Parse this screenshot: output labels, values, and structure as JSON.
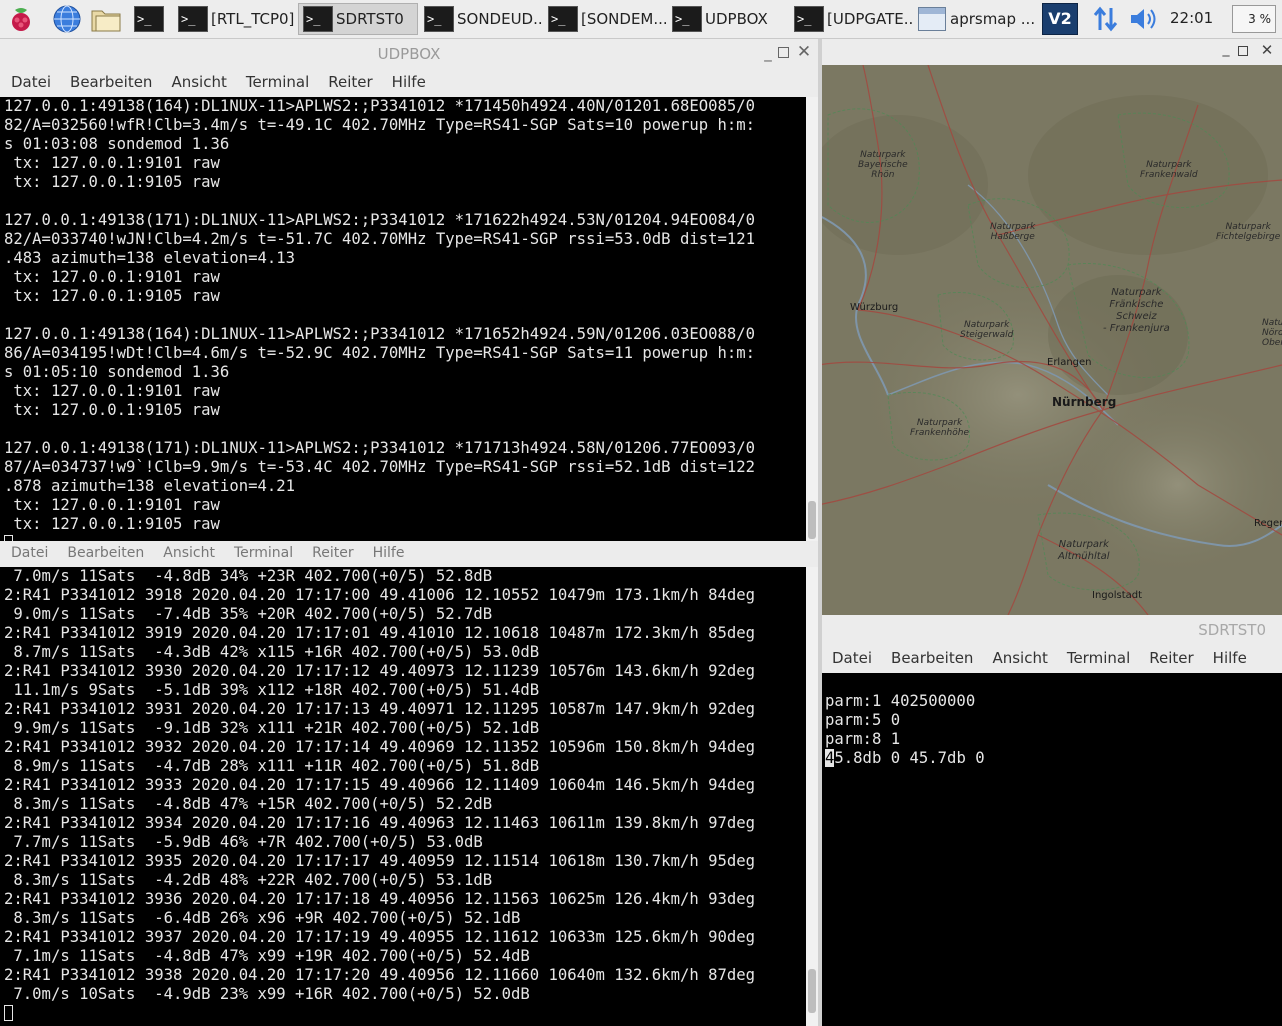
{
  "taskbar": {
    "tasks": [
      {
        "label": "",
        "glyph": ">_"
      },
      {
        "label": "[RTL_TCP0]",
        "glyph": ">_"
      },
      {
        "label": "SDRTST0",
        "glyph": ">_"
      },
      {
        "label": "SONDEUD...",
        "glyph": ">_"
      },
      {
        "label": "[SONDEM...",
        "glyph": ">_"
      },
      {
        "label": "UDPBOX",
        "glyph": ">_"
      },
      {
        "label": "[UDPGATE...",
        "glyph": ">_"
      },
      {
        "label": "aprsmap ...",
        "glyph": ""
      }
    ],
    "clock": "22:01",
    "cpu": "3 %",
    "vnc_label": "V2"
  },
  "udpbox": {
    "title": "UDPBOX",
    "menu": [
      "Datei",
      "Bearbeiten",
      "Ansicht",
      "Terminal",
      "Reiter",
      "Hilfe"
    ],
    "lines": [
      "127.0.0.1:49138(164):DL1NUX-11>APLWS2:;P3341012 *171450h4924.40N/01201.68EO085/0",
      "82/A=032560!wfR!Clb=3.4m/s t=-49.1C 402.70MHz Type=RS41-SGP Sats=10 powerup h:m:",
      "s 01:03:08 sondemod 1.36",
      " tx: 127.0.0.1:9101 raw",
      " tx: 127.0.0.1:9105 raw",
      "",
      "127.0.0.1:49138(171):DL1NUX-11>APLWS2:;P3341012 *171622h4924.53N/01204.94EO084/0",
      "82/A=033740!wJN!Clb=4.2m/s t=-51.7C 402.70MHz Type=RS41-SGP rssi=53.0dB dist=121",
      ".483 azimuth=138 elevation=4.13",
      " tx: 127.0.0.1:9101 raw",
      " tx: 127.0.0.1:9105 raw",
      "",
      "127.0.0.1:49138(164):DL1NUX-11>APLWS2:;P3341012 *171652h4924.59N/01206.03EO088/0",
      "86/A=034195!wDt!Clb=4.6m/s t=-52.9C 402.70MHz Type=RS41-SGP Sats=11 powerup h:m:",
      "s 01:05:10 sondemod 1.36",
      " tx: 127.0.0.1:9101 raw",
      " tx: 127.0.0.1:9105 raw",
      "",
      "127.0.0.1:49138(171):DL1NUX-11>APLWS2:;P3341012 *171713h4924.58N/01206.77EO093/0",
      "87/A=034737!w9`!Clb=9.9m/s t=-53.4C 402.70MHz Type=RS41-SGP rssi=52.1dB dist=122",
      ".878 azimuth=138 elevation=4.21",
      " tx: 127.0.0.1:9101 raw",
      " tx: 127.0.0.1:9105 raw"
    ]
  },
  "sondeud": {
    "ghost_menu": [
      "Datei",
      "Bearbeiten",
      "Ansicht",
      "Terminal",
      "Reiter",
      "Hilfe"
    ],
    "lines": [
      " 7.0m/s 11Sats  -4.8dB 34% +23R 402.700(+0/5) 52.8dB",
      "2:R41 P3341012 3918 2020.04.20 17:17:00 49.41006 12.10552 10479m 173.1km/h 84deg",
      " 9.0m/s 11Sats  -7.4dB 35% +20R 402.700(+0/5) 52.7dB",
      "2:R41 P3341012 3919 2020.04.20 17:17:01 49.41010 12.10618 10487m 172.3km/h 85deg",
      " 8.7m/s 11Sats  -4.3dB 42% x115 +16R 402.700(+0/5) 53.0dB",
      "2:R41 P3341012 3930 2020.04.20 17:17:12 49.40973 12.11239 10576m 143.6km/h 92deg",
      " 11.1m/s 9Sats  -5.1dB 39% x112 +18R 402.700(+0/5) 51.4dB",
      "2:R41 P3341012 3931 2020.04.20 17:17:13 49.40971 12.11295 10587m 147.9km/h 92deg",
      " 9.9m/s 11Sats  -9.1dB 32% x111 +21R 402.700(+0/5) 52.1dB",
      "2:R41 P3341012 3932 2020.04.20 17:17:14 49.40969 12.11352 10596m 150.8km/h 94deg",
      " 8.9m/s 11Sats  -4.7dB 28% x111 +11R 402.700(+0/5) 51.8dB",
      "2:R41 P3341012 3933 2020.04.20 17:17:15 49.40966 12.11409 10604m 146.5km/h 94deg",
      " 8.3m/s 11Sats  -4.8dB 47% +15R 402.700(+0/5) 52.2dB",
      "2:R41 P3341012 3934 2020.04.20 17:17:16 49.40963 12.11463 10611m 139.8km/h 97deg",
      " 7.7m/s 11Sats  -5.9dB 46% +7R 402.700(+0/5) 53.0dB",
      "2:R41 P3341012 3935 2020.04.20 17:17:17 49.40959 12.11514 10618m 130.7km/h 95deg",
      " 8.3m/s 11Sats  -4.2dB 48% +22R 402.700(+0/5) 53.1dB",
      "2:R41 P3341012 3936 2020.04.20 17:17:18 49.40956 12.11563 10625m 126.4km/h 93deg",
      " 8.3m/s 11Sats  -6.4dB 26% x96 +9R 402.700(+0/5) 52.1dB",
      "2:R41 P3341012 3937 2020.04.20 17:17:19 49.40955 12.11612 10633m 125.6km/h 90deg",
      " 7.1m/s 11Sats  -4.8dB 47% x99 +19R 402.700(+0/5) 52.4dB",
      "2:R41 P3341012 3938 2020.04.20 17:17:20 49.40956 12.11660 10640m 132.6km/h 87deg",
      " 7.0m/s 10Sats  -4.9dB 23% x99 +16R 402.700(+0/5) 52.0dB"
    ]
  },
  "sdrtst": {
    "title": "SDRTST0",
    "menu": [
      "Datei",
      "Bearbeiten",
      "Ansicht",
      "Terminal",
      "Reiter",
      "Hilfe"
    ],
    "lines": [
      "parm:1 402500000",
      "parm:5 0",
      "parm:8 1",
      "45.8db 0 45.7db 0"
    ]
  },
  "map": {
    "labels": [
      "Naturpark\nBayerische\nRhön",
      "Naturpark\nFrankenwald",
      "Naturpark\nHaßberge",
      "Naturpark\nFichtelgebirge",
      "Naturpark\nFränkische\nSchweiz\n- Frankenjura",
      "Würzburg",
      "Naturpark\nSteigerwald",
      "Erlangen",
      "Nürnberg",
      "Naturpark\nFrankenhöhe",
      "Regensb",
      "Naturpark\nAltmühltal",
      "Ingolstadt",
      "Natur\nNördl\nOberp"
    ]
  }
}
